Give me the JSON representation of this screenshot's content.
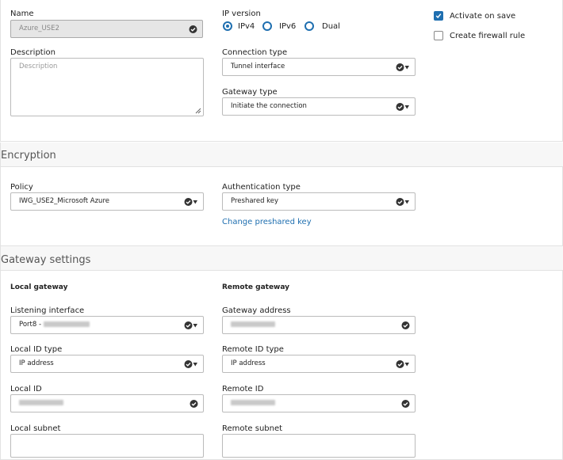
{
  "general": {
    "name": {
      "label": "Name",
      "value": "Azure_USE2"
    },
    "description": {
      "label": "Description",
      "placeholder": "Description"
    },
    "ip_version": {
      "label": "IP version",
      "options": [
        "IPv4",
        "IPv6",
        "Dual"
      ],
      "selected": "IPv4"
    },
    "activate_on_save": {
      "label": "Activate on save",
      "checked": true
    },
    "create_firewall_rule": {
      "label": "Create firewall rule",
      "checked": false
    },
    "connection_type": {
      "label": "Connection type",
      "value": "Tunnel interface"
    },
    "gateway_type": {
      "label": "Gateway type",
      "value": "Initiate the connection"
    }
  },
  "encryption": {
    "title": "Encryption",
    "policy": {
      "label": "Policy",
      "value": "IWG_USE2_Microsoft Azure"
    },
    "auth_type": {
      "label": "Authentication type",
      "value": "Preshared key"
    },
    "change_key_link": "Change preshared key"
  },
  "gateway": {
    "title": "Gateway settings",
    "local": {
      "heading": "Local gateway",
      "listening_interface": {
        "label": "Listening interface",
        "value_prefix": "Port8 - "
      },
      "local_id_type": {
        "label": "Local ID type",
        "value": "IP address"
      },
      "local_id": {
        "label": "Local ID"
      },
      "local_subnet": {
        "label": "Local subnet"
      }
    },
    "remote": {
      "heading": "Remote gateway",
      "gateway_address": {
        "label": "Gateway address"
      },
      "remote_id_type": {
        "label": "Remote ID type",
        "value": "IP address"
      },
      "remote_id": {
        "label": "Remote ID"
      },
      "remote_subnet": {
        "label": "Remote subnet"
      }
    }
  },
  "colors": {
    "accent": "#1f6fb0",
    "border": "#bbbbbb",
    "band": "#f7f7f7"
  }
}
